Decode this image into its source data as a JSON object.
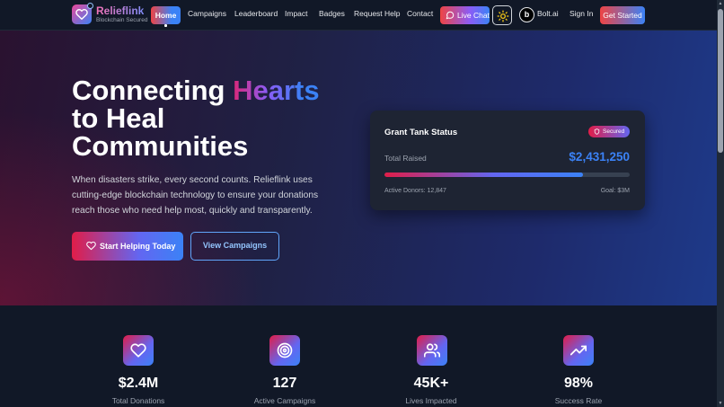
{
  "brand": {
    "name": "Relieflink",
    "tagline": "Blockchain Secured",
    "logo_icon": "heart-icon"
  },
  "nav": {
    "items": [
      {
        "label": "Home",
        "active": true
      },
      {
        "label": "Campaigns"
      },
      {
        "label": "Leaderboard"
      },
      {
        "label": "Impact"
      },
      {
        "label": "Badges"
      },
      {
        "label": "Request Help"
      },
      {
        "label": "Contact"
      }
    ],
    "live_chat": "Live Chat",
    "bolt_label": "Bolt.ai",
    "bolt_badge": "b",
    "sign_in": "Sign In",
    "get_started": "Get Started"
  },
  "hero": {
    "title_line1_part1": "Connecting ",
    "title_line1_highlight": "Hearts",
    "title_line2": "to Heal",
    "title_line3": "Communities",
    "subtitle": "When disasters strike, every second counts. Relieflink uses cutting-edge blockchain technology to ensure your donations reach those who need help most, quickly and transparently.",
    "primary_cta": "Start Helping Today",
    "secondary_cta": "View Campaigns"
  },
  "grant_card": {
    "title": "Grant Tank Status",
    "badge": "Secured",
    "raised_label": "Total Raised",
    "raised_value": "$2,431,250",
    "progress": 0.81,
    "donors": "Active Donors: 12,847",
    "goal": "Goal: $3M"
  },
  "stats": [
    {
      "icon": "heart-icon",
      "value": "$2.4M",
      "label": "Total Donations"
    },
    {
      "icon": "target-icon",
      "value": "127",
      "label": "Active Campaigns"
    },
    {
      "icon": "users-icon",
      "value": "45K+",
      "label": "Lives Impacted"
    },
    {
      "icon": "trending-up-icon",
      "value": "98%",
      "label": "Success Rate"
    }
  ],
  "colors": {
    "accent_pink": "#e11d48",
    "accent_blue": "#3b82f6",
    "background": "#0f172a"
  }
}
